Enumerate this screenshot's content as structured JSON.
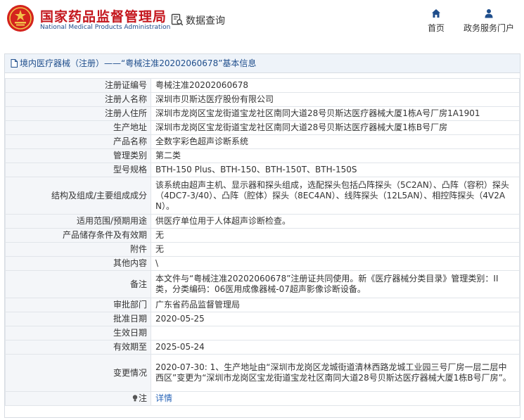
{
  "header": {
    "brand_cn": "国家药品监督管理局",
    "brand_en": "National Medical Products Administration",
    "query_label": "数据查询",
    "nav": [
      {
        "label": "首页",
        "icon": "home-icon"
      },
      {
        "label": "政务服务门户",
        "icon": "user-icon"
      }
    ]
  },
  "panel": {
    "title": "境内医疗器械（注册）——“粤械注准20202060678”基本信息"
  },
  "fields": [
    {
      "label": "注册证编号",
      "value": "粤械注准20202060678"
    },
    {
      "label": "注册人名称",
      "value": "深圳市贝斯达医疗股份有限公司"
    },
    {
      "label": "注册人住所",
      "value": "深圳市龙岗区宝龙街道宝龙社区南同大道28号贝斯达医疗器械大厦1栋A号厂房1A1901"
    },
    {
      "label": "生产地址",
      "value": "深圳市龙岗区宝龙街道宝龙社区南同大道28号贝斯达医疗器械大厦1栋B号厂房"
    },
    {
      "label": "产品名称",
      "value": "全数字彩色超声诊断系统"
    },
    {
      "label": "管理类别",
      "value": "第二类"
    },
    {
      "label": "型号规格",
      "value": "BTH-150 Plus、BTH-150、BTH-150T、BTH-150S"
    },
    {
      "label": "结构及组成/主要组成成分",
      "value": "该系统由超声主机、显示器和探头组成，选配探头包括凸阵探头（5C2AN）、凸阵（容积）探头（4DC7-3/40）、凸阵（腔体）探头（8EC4AN）、线阵探头（12L5AN）、相控阵探头（4V2AN）。"
    },
    {
      "label": "适用范围/预期用途",
      "value": "供医疗单位用于人体超声诊断检查。"
    },
    {
      "label": "产品储存条件及有效期",
      "value": "无"
    },
    {
      "label": "附件",
      "value": "无"
    },
    {
      "label": "其他内容",
      "value": "\\"
    },
    {
      "label": "备注",
      "value": "本文件与“粤械注准20202060678”注册证共同使用。新《医疗器械分类目录》管理类别：II类，分类编码：06医用成像器械-07超声影像诊断设备。"
    },
    {
      "label": "审批部门",
      "value": "广东省药品监督管理局"
    },
    {
      "label": "批准日期",
      "value": "2020-05-25"
    },
    {
      "label": "生效日期",
      "value": ""
    },
    {
      "label": "有效期至",
      "value": "2025-05-24"
    },
    {
      "label": "变更情况",
      "value": "2020-07-30: 1、生产地址由“深圳市龙岗区龙城街道清林西路龙城工业园三号厂房一层二层中西区”变更为“深圳市龙岗区宝龙街道宝龙社区南同大道28号贝斯达医疗器械大厦1栋B号厂房”。"
    }
  ],
  "note": {
    "label": "注",
    "link": "详情"
  }
}
